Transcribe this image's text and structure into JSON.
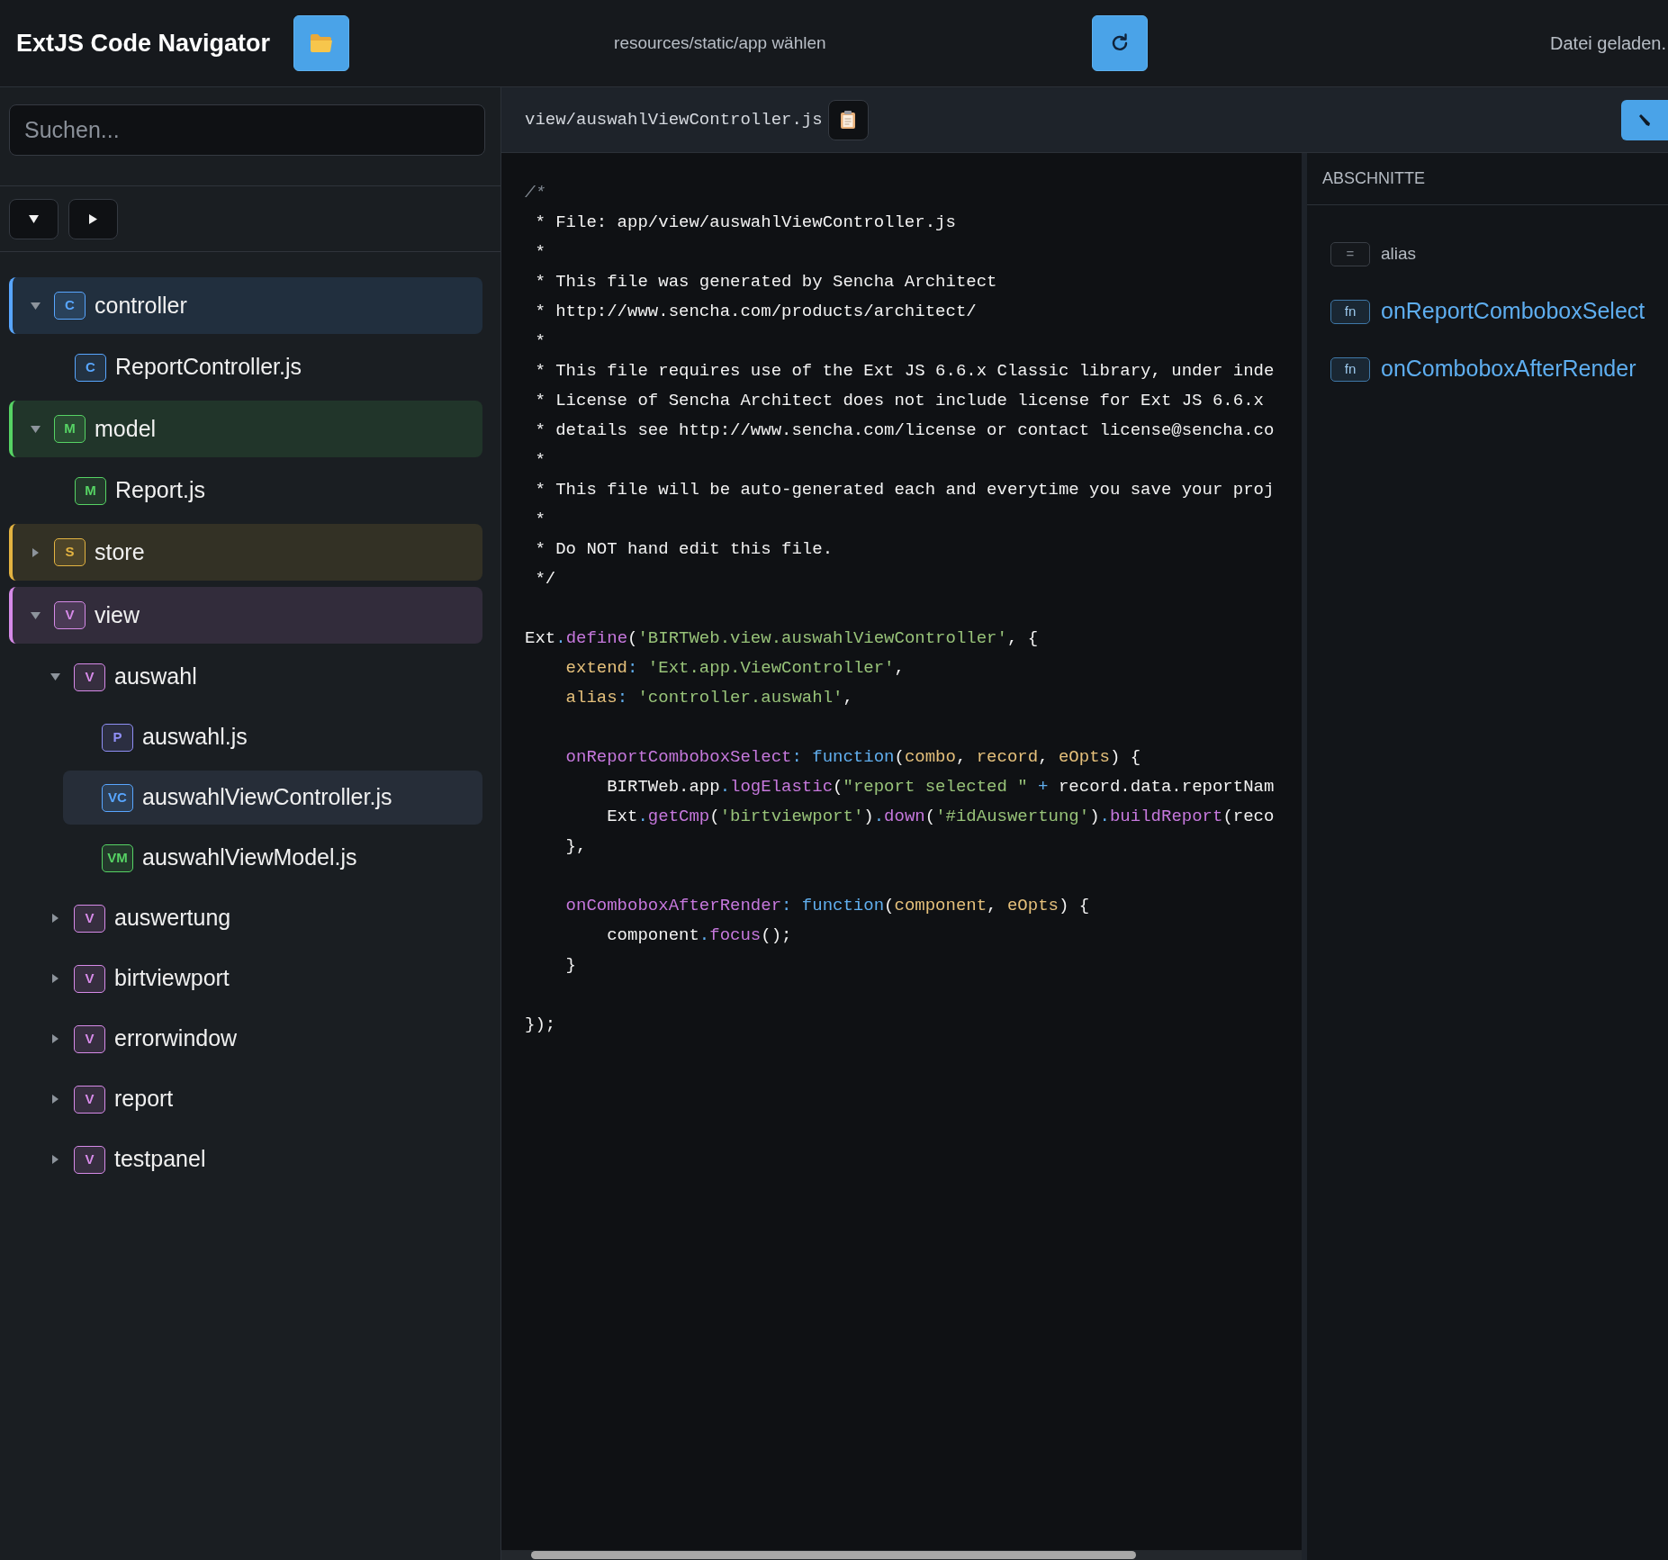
{
  "header": {
    "title": "ExtJS Code Navigator",
    "folder_hint": "resources/static/app wählen",
    "status": "Datei geladen."
  },
  "search": {
    "placeholder": "Suchen..."
  },
  "tree": [
    {
      "kind": "folder",
      "label": "controller",
      "badge": "C",
      "color": "#58a6ff",
      "expanded": true,
      "selected": false,
      "children": [
        {
          "kind": "file",
          "label": "ReportController.js",
          "badge": "C",
          "color": "#58a6ff",
          "selected": false
        }
      ]
    },
    {
      "kind": "folder",
      "label": "model",
      "badge": "M",
      "color": "#56d364",
      "expanded": true,
      "selected": false,
      "children": [
        {
          "kind": "file",
          "label": "Report.js",
          "badge": "M",
          "color": "#56d364",
          "selected": false
        }
      ]
    },
    {
      "kind": "folder",
      "label": "store",
      "badge": "S",
      "color": "#e3b341",
      "expanded": false,
      "selected": false
    },
    {
      "kind": "folder",
      "label": "view",
      "badge": "V",
      "color": "#d68ae8",
      "expanded": true,
      "selected": false,
      "children": [
        {
          "kind": "folder",
          "label": "auswahl",
          "badge": "V",
          "color": "#d68ae8",
          "expanded": true,
          "selected": false,
          "children": [
            {
              "kind": "file",
              "label": "auswahl.js",
              "badge": "P",
              "color": "#8f8ff5",
              "selected": false
            },
            {
              "kind": "file",
              "label": "auswahlViewController.js",
              "badge": "VC",
              "color": "#58a6ff",
              "selected": true
            },
            {
              "kind": "file",
              "label": "auswahlViewModel.js",
              "badge": "VM",
              "color": "#56d364",
              "selected": false
            }
          ]
        },
        {
          "kind": "folder",
          "label": "auswertung",
          "badge": "V",
          "color": "#d68ae8",
          "expanded": false,
          "selected": false
        },
        {
          "kind": "folder",
          "label": "birtviewport",
          "badge": "V",
          "color": "#d68ae8",
          "expanded": false,
          "selected": false
        },
        {
          "kind": "folder",
          "label": "errorwindow",
          "badge": "V",
          "color": "#d68ae8",
          "expanded": false,
          "selected": false
        },
        {
          "kind": "folder",
          "label": "report",
          "badge": "V",
          "color": "#d68ae8",
          "expanded": false,
          "selected": false
        },
        {
          "kind": "folder",
          "label": "testpanel",
          "badge": "V",
          "color": "#d68ae8",
          "expanded": false,
          "selected": false
        }
      ]
    }
  ],
  "editor": {
    "path": "view/auswahlViewController.js"
  },
  "code": [
    {
      "kind": "code",
      "tokens": [
        {
          "kind": "comment",
          "text": "/*"
        }
      ]
    },
    {
      "kind": "code",
      "tokens": [
        {
          "kind": "plain",
          "text": " * File: app/view/auswahlViewController.js"
        }
      ]
    },
    {
      "kind": "code",
      "tokens": [
        {
          "kind": "plain",
          "text": " *"
        }
      ]
    },
    {
      "kind": "code",
      "tokens": [
        {
          "kind": "plain",
          "text": " * This file was generated by Sencha Architect"
        }
      ]
    },
    {
      "kind": "code",
      "tokens": [
        {
          "kind": "plain",
          "text": " * http://www.sencha.com/products/architect/"
        }
      ]
    },
    {
      "kind": "code",
      "tokens": [
        {
          "kind": "plain",
          "text": " *"
        }
      ]
    },
    {
      "kind": "code",
      "tokens": [
        {
          "kind": "plain",
          "text": " * This file requires use of the Ext JS 6.6.x Classic library, under inde"
        }
      ]
    },
    {
      "kind": "code",
      "tokens": [
        {
          "kind": "plain",
          "text": " * License of Sencha Architect does not include license for Ext JS 6.6.x"
        }
      ]
    },
    {
      "kind": "code",
      "tokens": [
        {
          "kind": "plain",
          "text": " * details see http://www.sencha.com/license or contact license@sencha.co"
        }
      ]
    },
    {
      "kind": "code",
      "tokens": [
        {
          "kind": "plain",
          "text": " *"
        }
      ]
    },
    {
      "kind": "code",
      "tokens": [
        {
          "kind": "plain",
          "text": " * This file will be auto-generated each and everytime you save your proj"
        }
      ]
    },
    {
      "kind": "code",
      "tokens": [
        {
          "kind": "plain",
          "text": " *"
        }
      ]
    },
    {
      "kind": "code",
      "tokens": [
        {
          "kind": "plain",
          "text": " * Do NOT hand edit this file."
        }
      ]
    },
    {
      "kind": "code",
      "tokens": [
        {
          "kind": "plain",
          "text": " */"
        }
      ]
    },
    {
      "kind": "blank"
    },
    {
      "kind": "code",
      "tokens": [
        {
          "kind": "plain",
          "text": "Ext"
        },
        {
          "kind": "op",
          "text": "."
        },
        {
          "kind": "method",
          "text": "define"
        },
        {
          "kind": "plain",
          "text": "("
        },
        {
          "kind": "string",
          "text": "'BIRTWeb.view.auswahlViewController'"
        },
        {
          "kind": "plain",
          "text": ", {"
        }
      ]
    },
    {
      "kind": "code",
      "tokens": [
        {
          "kind": "prop",
          "text": "    extend"
        },
        {
          "kind": "op",
          "text": ": "
        },
        {
          "kind": "string",
          "text": "'Ext.app.ViewController'"
        },
        {
          "kind": "plain",
          "text": ","
        }
      ]
    },
    {
      "kind": "code",
      "tokens": [
        {
          "kind": "prop",
          "text": "    alias"
        },
        {
          "kind": "op",
          "text": ": "
        },
        {
          "kind": "string",
          "text": "'controller.auswahl'"
        },
        {
          "kind": "plain",
          "text": ","
        }
      ]
    },
    {
      "kind": "blank"
    },
    {
      "kind": "code",
      "tokens": [
        {
          "kind": "method",
          "text": "    onReportComboboxSelect"
        },
        {
          "kind": "op",
          "text": ": "
        },
        {
          "kind": "keyword",
          "text": "function"
        },
        {
          "kind": "plain",
          "text": "("
        },
        {
          "kind": "param",
          "text": "combo"
        },
        {
          "kind": "plain",
          "text": ", "
        },
        {
          "kind": "param",
          "text": "record"
        },
        {
          "kind": "plain",
          "text": ", "
        },
        {
          "kind": "param",
          "text": "eOpts"
        },
        {
          "kind": "plain",
          "text": ") {"
        }
      ]
    },
    {
      "kind": "code",
      "tokens": [
        {
          "kind": "plain",
          "text": "        BIRTWeb.app"
        },
        {
          "kind": "op",
          "text": "."
        },
        {
          "kind": "method",
          "text": "logElastic"
        },
        {
          "kind": "plain",
          "text": "("
        },
        {
          "kind": "string",
          "text": "\"report selected \""
        },
        {
          "kind": "op",
          "text": " + "
        },
        {
          "kind": "plain",
          "text": "record.data.reportNam"
        }
      ]
    },
    {
      "kind": "code",
      "tokens": [
        {
          "kind": "plain",
          "text": "        Ext"
        },
        {
          "kind": "op",
          "text": "."
        },
        {
          "kind": "method",
          "text": "getCmp"
        },
        {
          "kind": "plain",
          "text": "("
        },
        {
          "kind": "string",
          "text": "'birtviewport'"
        },
        {
          "kind": "plain",
          "text": ")"
        },
        {
          "kind": "op",
          "text": "."
        },
        {
          "kind": "method",
          "text": "down"
        },
        {
          "kind": "plain",
          "text": "("
        },
        {
          "kind": "string",
          "text": "'#idAuswertung'"
        },
        {
          "kind": "plain",
          "text": ")"
        },
        {
          "kind": "op",
          "text": "."
        },
        {
          "kind": "method",
          "text": "buildReport"
        },
        {
          "kind": "plain",
          "text": "(reco"
        }
      ]
    },
    {
      "kind": "code",
      "tokens": [
        {
          "kind": "plain",
          "text": "    },"
        }
      ]
    },
    {
      "kind": "blank"
    },
    {
      "kind": "code",
      "tokens": [
        {
          "kind": "method",
          "text": "    onComboboxAfterRender"
        },
        {
          "kind": "op",
          "text": ": "
        },
        {
          "kind": "keyword",
          "text": "function"
        },
        {
          "kind": "plain",
          "text": "("
        },
        {
          "kind": "param",
          "text": "component"
        },
        {
          "kind": "plain",
          "text": ", "
        },
        {
          "kind": "param",
          "text": "eOpts"
        },
        {
          "kind": "plain",
          "text": ") {"
        }
      ]
    },
    {
      "kind": "code",
      "tokens": [
        {
          "kind": "plain",
          "text": "        component"
        },
        {
          "kind": "op",
          "text": "."
        },
        {
          "kind": "method",
          "text": "focus"
        },
        {
          "kind": "plain",
          "text": "();"
        }
      ]
    },
    {
      "kind": "code",
      "tokens": [
        {
          "kind": "plain",
          "text": "    }"
        }
      ]
    },
    {
      "kind": "blank"
    },
    {
      "kind": "code",
      "tokens": [
        {
          "kind": "plain",
          "text": "});"
        }
      ]
    }
  ],
  "sections": {
    "title": "ABSCHNITTE",
    "items": [
      {
        "kind": "property",
        "badge": "=",
        "label": "alias"
      },
      {
        "kind": "function",
        "badge": "fn",
        "label": "onReportComboboxSelect"
      },
      {
        "kind": "function",
        "badge": "fn",
        "label": "onComboboxAfterRender"
      }
    ]
  }
}
